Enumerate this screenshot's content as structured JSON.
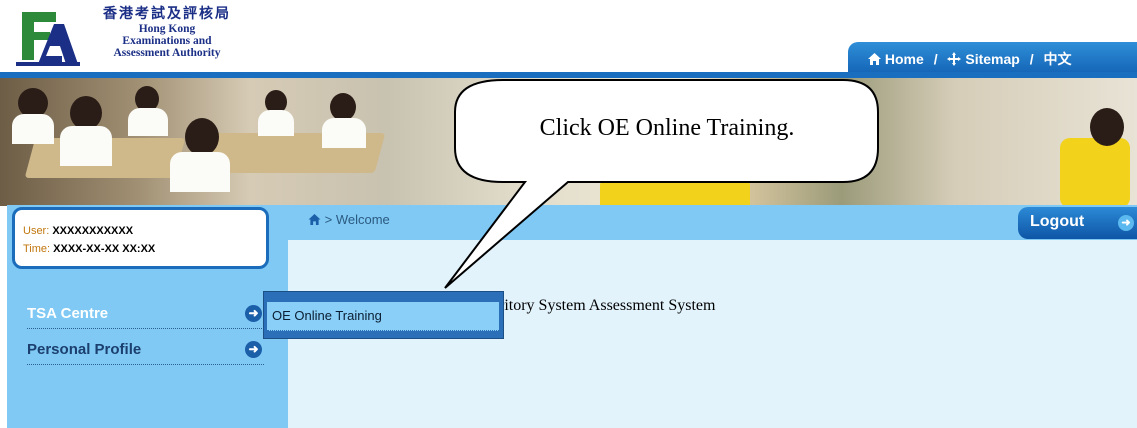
{
  "header": {
    "logo_cn": "香港考試及評核局",
    "logo_en_1": "Hong Kong",
    "logo_en_2": "Examinations and",
    "logo_en_3": "Assessment Authority",
    "nav_home": "Home",
    "nav_sitemap": "Sitemap",
    "nav_lang": "中文",
    "nav_separator": "/"
  },
  "user": {
    "user_label": "User:",
    "user_value": "XXXXXXXXXXX",
    "time_label": "Time:",
    "time_value": "XXXX-XX-XX XX:XX"
  },
  "sidebar": {
    "items": [
      {
        "label": "TSA Centre"
      },
      {
        "label": "Personal Profile"
      }
    ]
  },
  "breadcrumb": {
    "separator": ">",
    "current": "Welcome"
  },
  "logout_label": "Logout",
  "main": {
    "title_fragment": "ritory System Assessment System"
  },
  "submenu": {
    "items": [
      {
        "label": "OE Online Training"
      }
    ]
  },
  "callout": {
    "text": "Click OE Online Training."
  },
  "colors": {
    "brand_blue": "#1a6ec0",
    "sidebar_blue": "#7fc9f4",
    "label_orange": "#c2770e"
  }
}
